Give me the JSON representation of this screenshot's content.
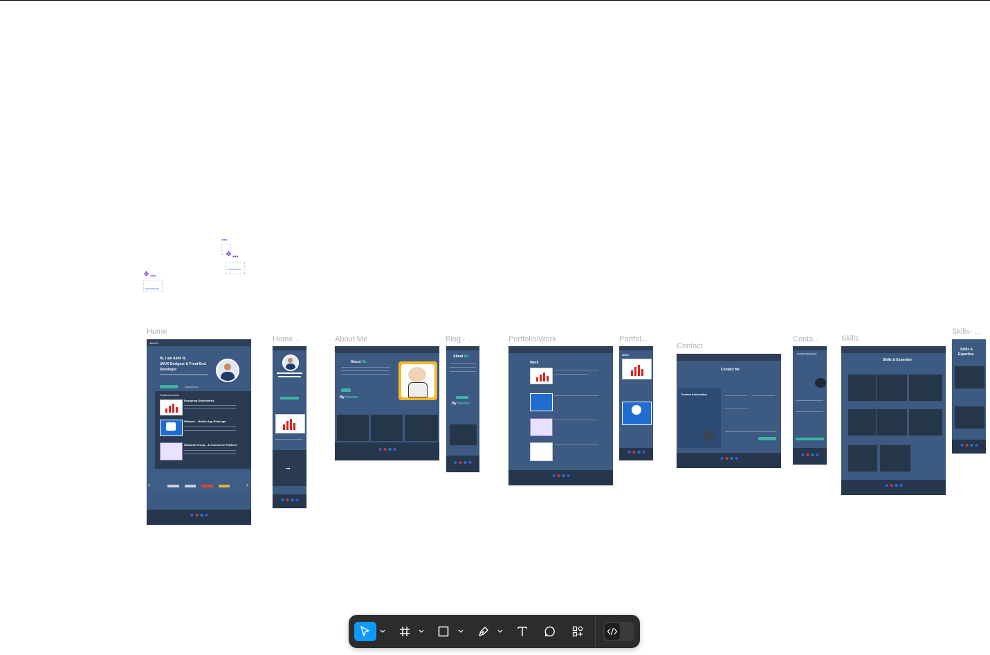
{
  "canvas": {
    "frames": [
      {
        "label": "Home"
      },
      {
        "label": "Home ..."
      },
      {
        "label": "About Me"
      },
      {
        "label": "Blog - ..."
      },
      {
        "label": "Portfolio/Work"
      },
      {
        "label": "Portfol..."
      },
      {
        "label": "Contact"
      },
      {
        "label": "Conta..."
      },
      {
        "label": "Skills"
      },
      {
        "label": "Skills- ..."
      }
    ],
    "home_frame": {
      "brand": "Akhil N",
      "hero_line1": "Hi, I am Akhil N,",
      "hero_line2": "UI/UX Designer & Front-End",
      "hero_line3": "Developer",
      "section": "Featured works",
      "works": [
        "Designing Dashboards",
        "Walmart – Mobile App Redesign",
        "Dhanush Group – E-Commerce Platform"
      ]
    },
    "about_frame": {
      "title_a": "About",
      "title_b": "Me",
      "service_a": "My",
      "service_b": "Service"
    },
    "blog_frame": {
      "title_a": "About",
      "title_b": "Me",
      "service_a": "My",
      "service_b": "Service"
    },
    "portfolio_frame": {
      "title": "Work"
    },
    "portfolio_mobile": {
      "title": "Work"
    },
    "contact_frame": {
      "title": "Contact Me",
      "info": "Contact Information"
    },
    "contact_mobile": {
      "title": "Contact Information"
    },
    "skills_frame": {
      "title": "Skills & Expertise"
    },
    "skills_mobile": {
      "title_line1": "Skills &",
      "title_line2": "Expertise"
    }
  },
  "toolbar": {
    "tools": [
      "move-tool",
      "frame-tool",
      "shape-tool",
      "pen-tool",
      "text-tool",
      "comment-tool",
      "actions-tool",
      "dev-mode-toggle"
    ],
    "accent": "#0d99ff"
  },
  "colors": {
    "frame_bg": "#3c5a82",
    "nav_bg": "#2d3e56",
    "teal": "#3fb3a5"
  }
}
